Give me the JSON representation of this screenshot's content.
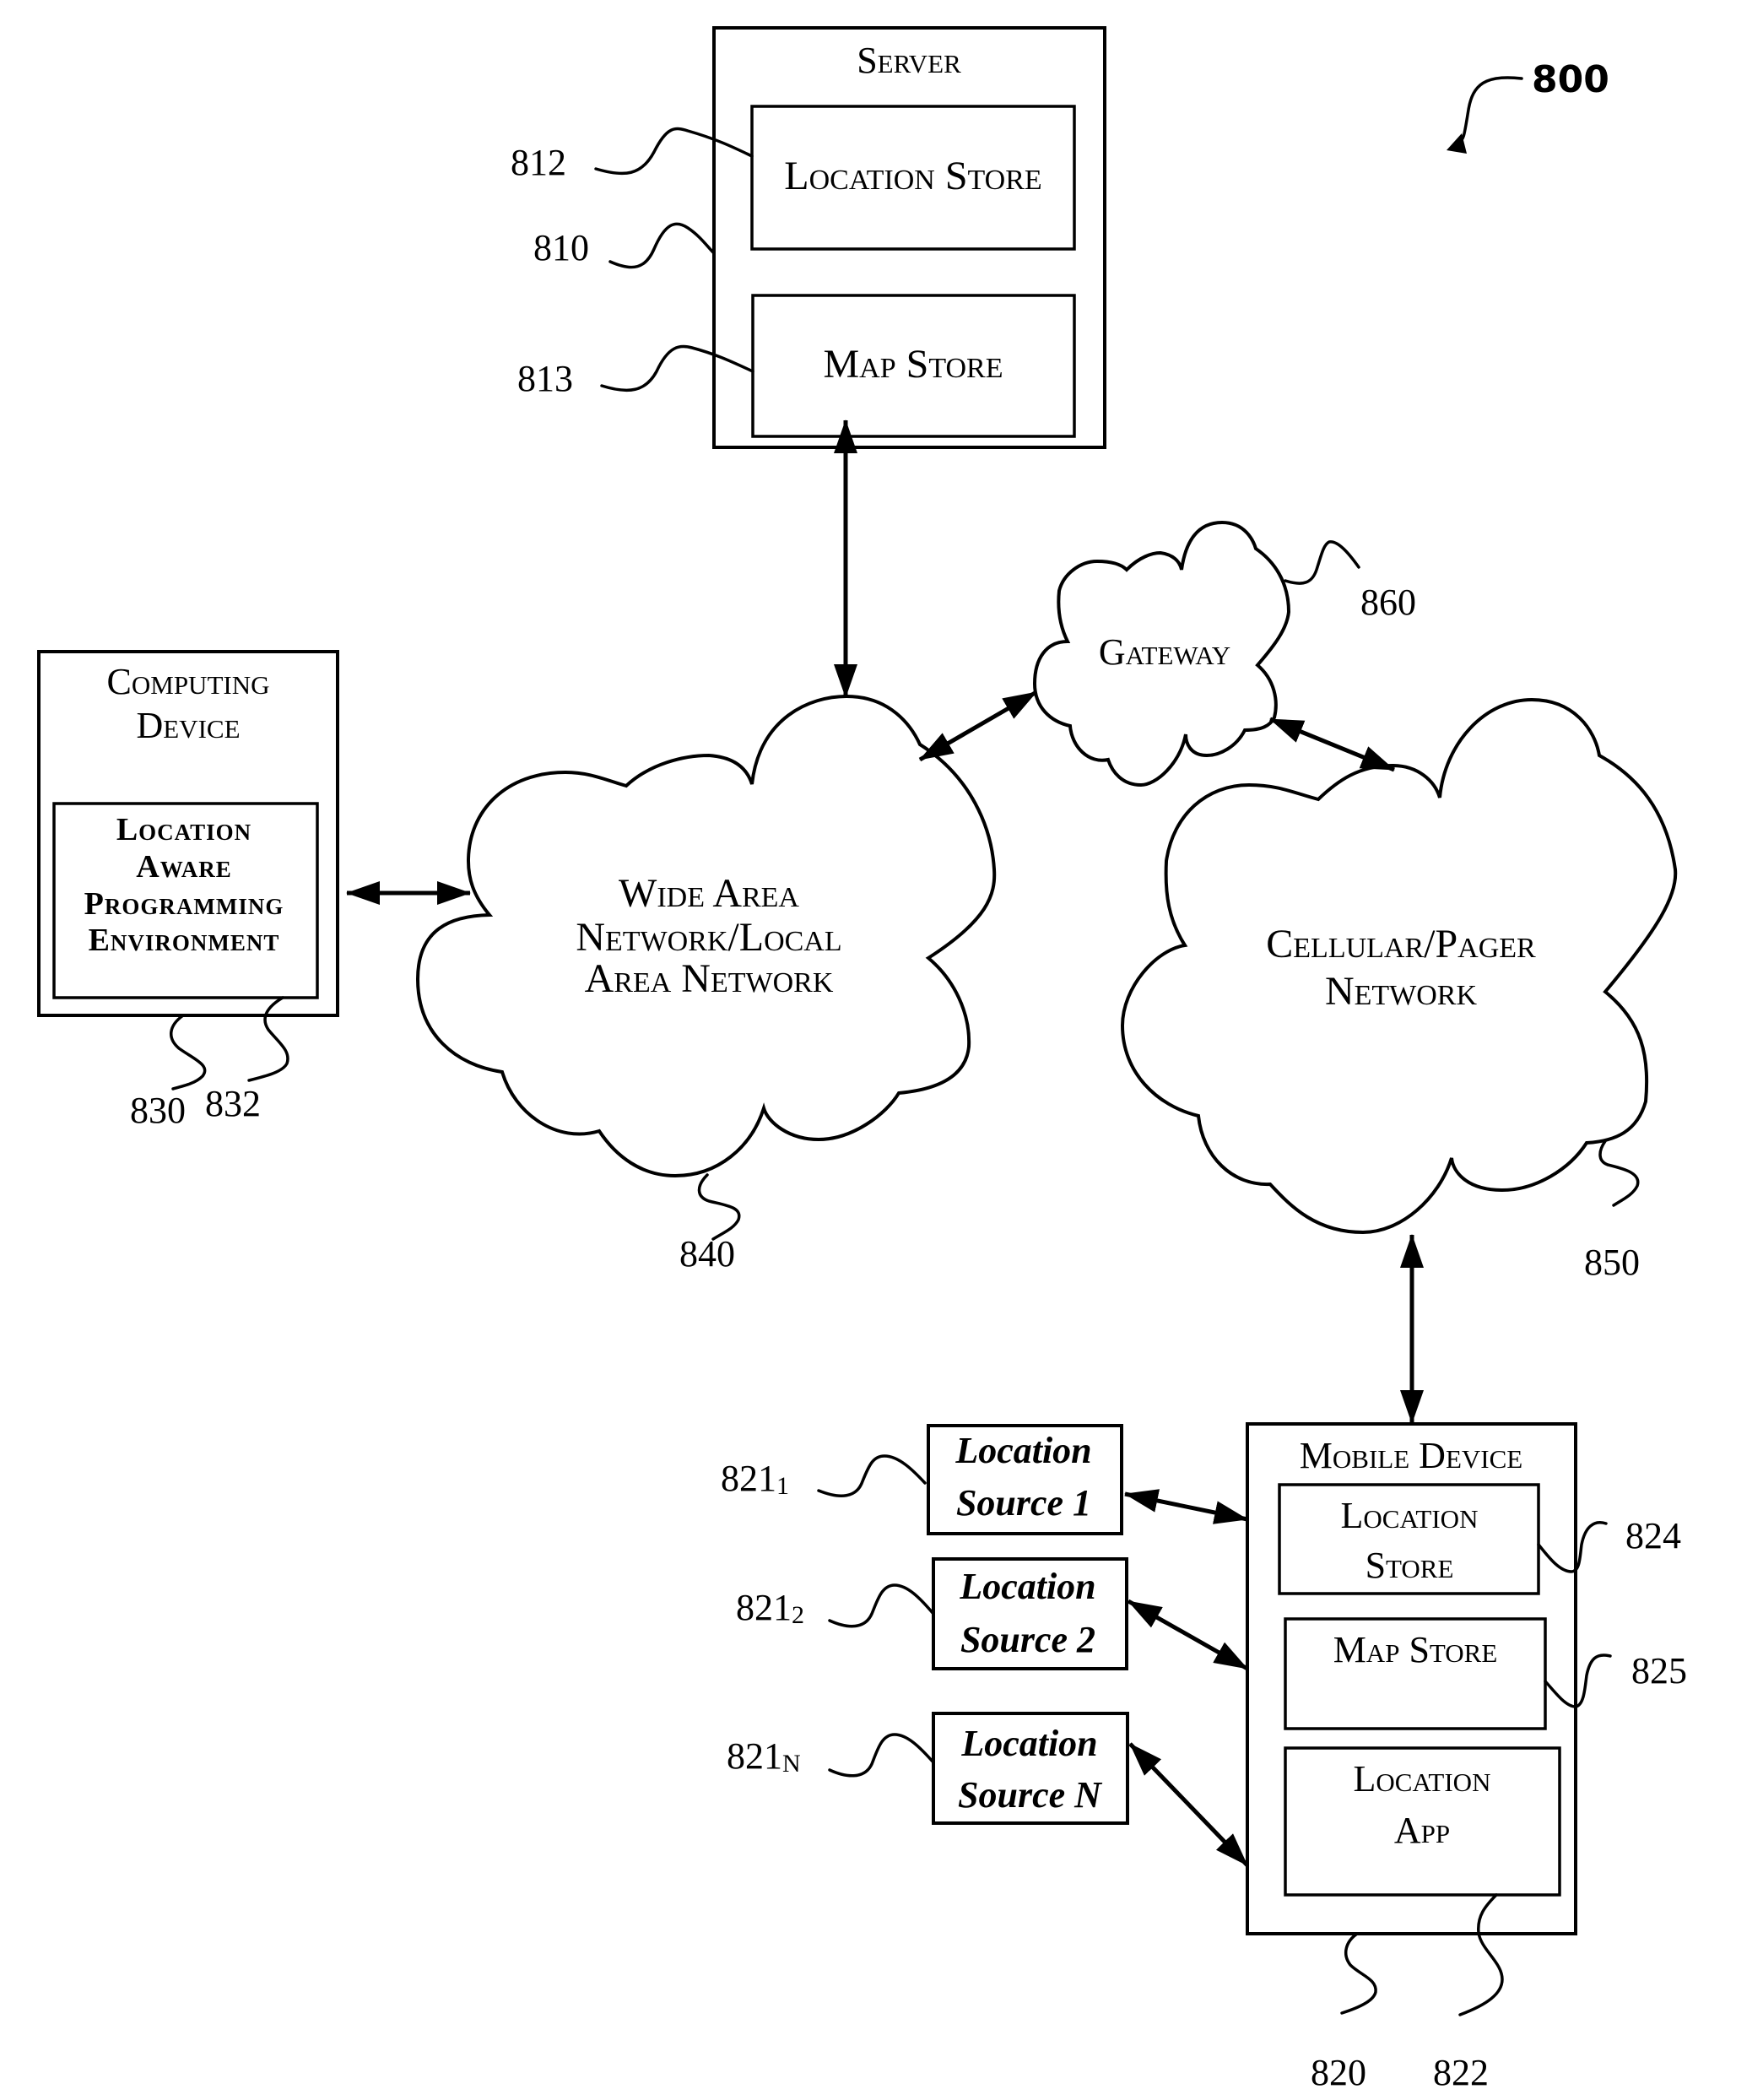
{
  "figure": {
    "number": "800"
  },
  "server": {
    "title": "Server",
    "ref": "810",
    "location_store": {
      "label": "Location Store",
      "ref": "812"
    },
    "map_store": {
      "label": "Map Store",
      "ref": "813"
    }
  },
  "computing_device": {
    "title_lines": [
      "Computing",
      "Device"
    ],
    "ref": "830",
    "environment": {
      "lines": [
        "Location",
        "Aware",
        "Programming",
        "Environment"
      ],
      "ref": "832"
    }
  },
  "wan": {
    "lines": [
      "Wide Area",
      "Network/Local",
      "Area Network"
    ],
    "ref": "840"
  },
  "gateway": {
    "label": "Gateway",
    "ref": "860"
  },
  "cellular": {
    "lines": [
      "Cellular/Pager",
      "Network"
    ],
    "ref": "850"
  },
  "mobile_device": {
    "title": "Mobile Device",
    "ref": "820",
    "location_store": {
      "lines": [
        "Location",
        "Store"
      ],
      "ref": "824"
    },
    "map_store": {
      "label": "Map Store",
      "ref": "825"
    },
    "location_app": {
      "lines": [
        "Location",
        "App"
      ],
      "ref": "822"
    }
  },
  "location_sources": [
    {
      "line1": "Location",
      "line2": "Source 1",
      "ref_base": "821",
      "ref_sub": "1"
    },
    {
      "line1": "Location",
      "line2": "Source 2",
      "ref_base": "821",
      "ref_sub": "2"
    },
    {
      "line1": "Location",
      "line2": "Source N",
      "ref_base": "821",
      "ref_sub": "N"
    }
  ]
}
